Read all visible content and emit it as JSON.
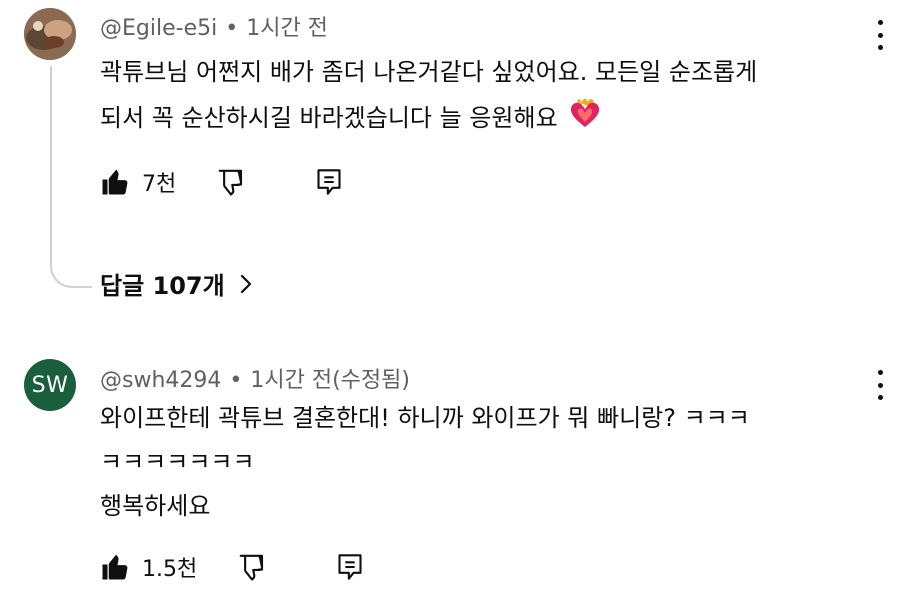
{
  "comments": [
    {
      "author": "@Egile-e5i",
      "time": "1시간 전",
      "lines": [
        "곽튜브님 어쩐지 배가 좀더 나온거같다 싶었어요. 모든일 순조롭게",
        "되서 꼭 순산하시길 바라겠습니다 늘 응원해요"
      ],
      "likes": "7천",
      "replies_label": "답글 107개",
      "avatar_icon": "photo-avatar"
    },
    {
      "author": "@swh4294",
      "time": "1시간 전(수정됨)",
      "avatar_text": "SW",
      "lines": [
        "와이프한테 곽튜브 결혼한대! 하니까 와이프가 뭐 빠니랑? ㅋㅋㅋ",
        "ㅋㅋㅋㅋㅋㅋㅋ",
        "행복하세요"
      ],
      "likes": "1.5천"
    }
  ],
  "separator": "•",
  "colors": {
    "avatar_sw": "#1b5e3c",
    "heart": "#e0245e",
    "thread": "#d0d0d0"
  }
}
